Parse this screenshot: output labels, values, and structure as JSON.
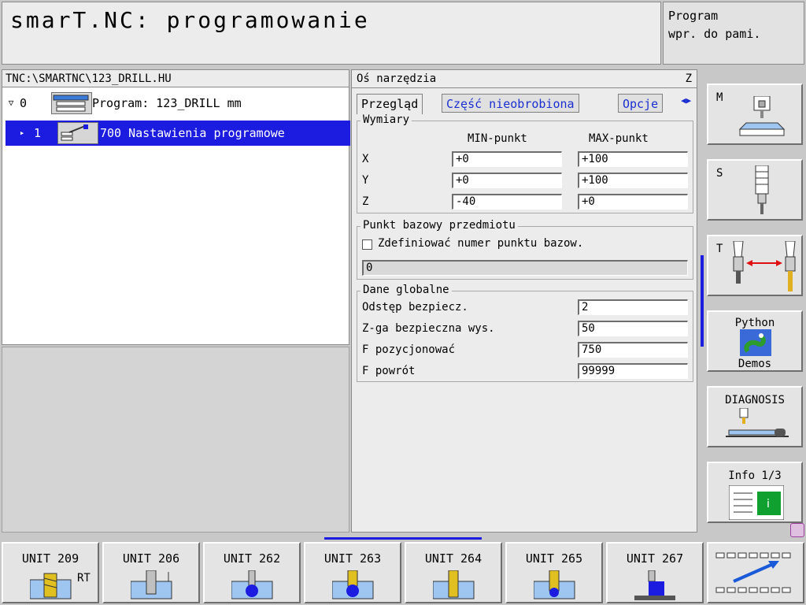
{
  "header": {
    "title": "smarT.NC: programowanie",
    "status_line1": "Program",
    "status_line2": "wpr. do pami."
  },
  "tree": {
    "path": "TNC:\\SMARTNC\\123_DRILL.HU",
    "rows": [
      {
        "num": "0",
        "label": "Program: 123_DRILL mm",
        "expanded": true
      },
      {
        "num": "1",
        "label": "700 Nastawienia programowe",
        "selected": true
      }
    ]
  },
  "form": {
    "axis_label": "Oś narzędzia",
    "axis_value": "Z",
    "tabs": [
      "Przegląd",
      "Część nieobrobiona",
      "Opcje"
    ],
    "active_tab": "Przegląd",
    "dims": {
      "legend": "Wymiary",
      "min_header": "MIN-punkt",
      "max_header": "MAX-punkt",
      "rows": [
        {
          "axis": "X",
          "min": "+0",
          "max": "+100"
        },
        {
          "axis": "Y",
          "min": "+0",
          "max": "+100"
        },
        {
          "axis": "Z",
          "min": "-40",
          "max": "+0"
        }
      ]
    },
    "datum": {
      "legend": "Punkt bazowy przedmiotu",
      "checkbox_label": "Zdefiniować numer punktu bazow.",
      "checked": false,
      "value": "0"
    },
    "global": {
      "legend": "Dane globalne",
      "rows": [
        {
          "label": "Odstęp bezpiecz.",
          "value": "2"
        },
        {
          "label": "Z-ga bezpieczna wys.",
          "value": "50"
        },
        {
          "label": "F pozycjonować",
          "value": "750"
        },
        {
          "label": "F powrót",
          "value": "99999"
        }
      ]
    }
  },
  "side_buttons": [
    {
      "label": "M",
      "icon": "machine-icon"
    },
    {
      "label": "S",
      "icon": "spindle-icon"
    },
    {
      "label": "T",
      "icon": "tool-change-icon"
    },
    {
      "label": "Python",
      "label2": "Demos",
      "icon": "python-icon"
    },
    {
      "label": "DIAGNOSIS",
      "icon": "diagnosis-icon"
    },
    {
      "label": "Info 1/3",
      "icon": "info-icon"
    }
  ],
  "softkeys": [
    {
      "label": "UNIT 209",
      "sub": "RT"
    },
    {
      "label": "UNIT 206"
    },
    {
      "label": "UNIT 262"
    },
    {
      "label": "UNIT 263"
    },
    {
      "label": "UNIT 264"
    },
    {
      "label": "UNIT 265"
    },
    {
      "label": "UNIT 267"
    },
    {
      "label": "",
      "icon": "next-softkey-row-icon"
    }
  ],
  "colors": {
    "selection": "#1c1ce0",
    "tab_text": "#1a2fd0",
    "panel_bg": "#ececec"
  }
}
